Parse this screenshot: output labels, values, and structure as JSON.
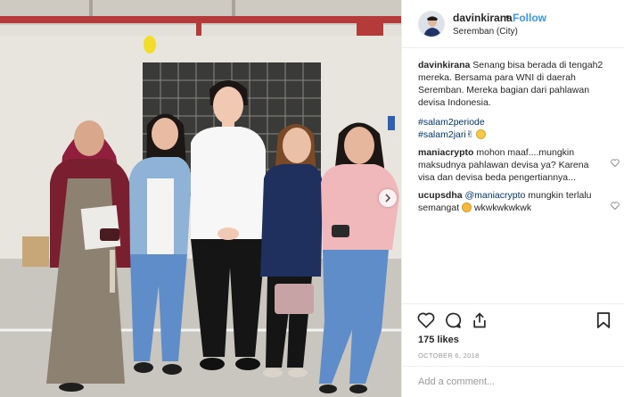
{
  "post": {
    "username": "davinkirana",
    "separator": "•",
    "follow_label": "Follow",
    "location": "Seremban (City)",
    "caption": {
      "user": "davinkirana",
      "text": "Senang bisa berada di tengah2 mereka. Bersama para WNI di daerah Seremban. Mereka bagian dari pahlawan devisa Indonesia.",
      "hashtags": [
        "#salam2periode",
        "#salam2jari✌"
      ]
    },
    "comments": [
      {
        "user": "maniacrypto",
        "text": "mohon maaf....mungkin maksudnya pahlawan devisa ya? Karena visa dan devisa beda pengertiannya..."
      },
      {
        "user": "ucupsdha",
        "mention": "@maniacrypto",
        "text": "mungkin terlalu semangat",
        "text_after": "wkwkwkwkwk"
      }
    ],
    "likes": "175 likes",
    "date": "OCTOBER 6, 2018",
    "add_comment_placeholder": "Add a comment..."
  },
  "icons": {
    "like": "heart-icon",
    "comment": "comment-icon",
    "share": "share-icon",
    "save": "bookmark-icon",
    "next": "chevron-right-icon"
  },
  "colors": {
    "link": "#3897f0",
    "hashtag": "#003569",
    "muted": "#999999",
    "text": "#262626"
  }
}
